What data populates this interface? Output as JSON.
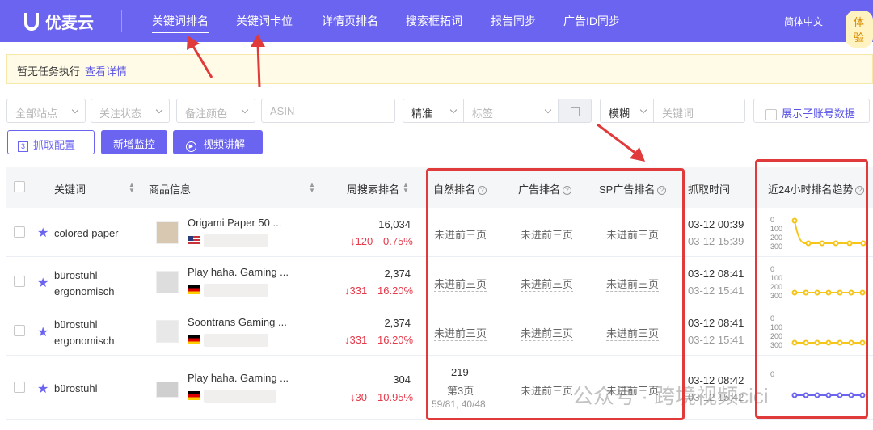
{
  "header": {
    "logo": "优麦云",
    "nav": [
      "关键词排名",
      "关键词卡位",
      "详情页排名",
      "搜索框拓词",
      "报告同步",
      "广告ID同步"
    ],
    "lang": "简体中文",
    "trial": "体验"
  },
  "notice": {
    "text": "暂无任务执行",
    "link": "查看详情"
  },
  "filters": {
    "site": "全部站点",
    "follow": "关注状态",
    "note_color": "备注颜色",
    "asin": "ASIN",
    "match1": "精准",
    "tag": "标签",
    "match2": "模糊",
    "keyword": "关键词",
    "subaccount": "展示子账号数据"
  },
  "actions": {
    "fetch": "抓取配置",
    "fetch_num": "3",
    "add": "新增监控",
    "video": "视频讲解"
  },
  "columns": {
    "keyword": "关键词",
    "product": "商品信息",
    "weekly": "周搜索排名",
    "organic": "自然排名",
    "ad": "广告排名",
    "sp": "SP广告排名",
    "time": "抓取时间",
    "trend": "近24小时排名趋势"
  },
  "rows": [
    {
      "keyword": "colored paper",
      "product": "Origami Paper 50 ...",
      "rank": "16,034",
      "change": "↓120",
      "pct": "0.75%",
      "organic": "未进前三页",
      "ad": "未进前三页",
      "sp": "未进前三页",
      "time1": "03-12 00:39",
      "time2": "03-12 15:39",
      "axis": [
        "0",
        "100",
        "200",
        "300"
      ]
    },
    {
      "keyword": "bürostuhl ergonomisch",
      "product": "Play haha. Gaming ...",
      "rank": "2,374",
      "change": "↓331",
      "pct": "16.20%",
      "organic": "未进前三页",
      "ad": "未进前三页",
      "sp": "未进前三页",
      "time1": "03-12 08:41",
      "time2": "03-12 15:41",
      "axis": [
        "0",
        "100",
        "200",
        "300"
      ]
    },
    {
      "keyword": "bürostuhl ergonomisch",
      "product": "Soontrans Gaming ...",
      "rank": "2,374",
      "change": "↓331",
      "pct": "16.20%",
      "organic": "未进前三页",
      "ad": "未进前三页",
      "sp": "未进前三页",
      "time1": "03-12 08:41",
      "time2": "03-12 15:41",
      "axis": [
        "0",
        "100",
        "200",
        "300"
      ]
    },
    {
      "keyword": "bürostuhl",
      "product": "Play haha. Gaming ...",
      "rank": "304",
      "change": "↓30",
      "pct": "10.95%",
      "organic": "219",
      "organic_page": "第3页",
      "organic_pos": "59/81, 40/48",
      "ad": "未进前三页",
      "sp": "未进前三页",
      "time1": "03-12 08:42",
      "time2": "03-12 15:42",
      "axis": [
        "0"
      ]
    }
  ],
  "watermark": "公众号 · 跨境视频cici",
  "colors": {
    "brand": "#6b64f0",
    "highlight": "#e03a3a",
    "decline": "#e6394a"
  }
}
